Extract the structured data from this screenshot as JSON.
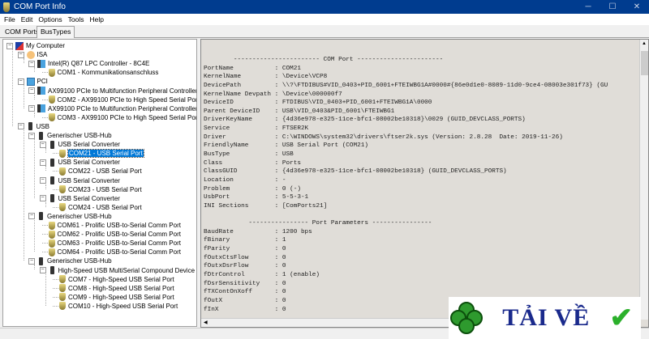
{
  "window": {
    "title": "COM Port Info",
    "controls": [
      "─",
      "☐",
      "✕"
    ]
  },
  "menu": [
    "File",
    "Edit",
    "Options",
    "Tools",
    "Help"
  ],
  "tabs": [
    {
      "label": "COM Ports",
      "active": false
    },
    {
      "label": "BusTypes",
      "active": true
    }
  ],
  "tree": [
    {
      "level": 0,
      "label": "My Computer",
      "icon": "computer",
      "toggle": "−"
    },
    {
      "level": 1,
      "label": "ISA",
      "icon": "isa",
      "toggle": "−"
    },
    {
      "level": 2,
      "label": "Intel(R) Q87 LPC Controller - 8C4E",
      "icon": "controller",
      "toggle": "−"
    },
    {
      "level": 3,
      "label": "COM1 - Kommunikationsanschluss",
      "icon": "port"
    },
    {
      "level": 1,
      "label": "PCI",
      "icon": "bus",
      "toggle": "−"
    },
    {
      "level": 2,
      "label": "AX99100 PCIe to Multifunction Peripheral Controller",
      "icon": "controller",
      "toggle": "−"
    },
    {
      "level": 3,
      "label": "COM2 - AX99100 PCIe to High Speed Serial Port",
      "icon": "port"
    },
    {
      "level": 2,
      "label": "AX99100 PCIe to Multifunction Peripheral Controller",
      "icon": "controller",
      "toggle": "−"
    },
    {
      "level": 3,
      "label": "COM3 - AX99100 PCIe to High Speed Serial Port",
      "icon": "port"
    },
    {
      "level": 1,
      "label": "USB",
      "icon": "usb",
      "toggle": "−"
    },
    {
      "level": 2,
      "label": "Generischer USB-Hub",
      "icon": "usb",
      "toggle": "−"
    },
    {
      "level": 3,
      "label": "USB Serial Converter",
      "icon": "usb",
      "toggle": "−"
    },
    {
      "level": 4,
      "label": "COM21 - USB Serial Port",
      "icon": "port",
      "selected": true
    },
    {
      "level": 3,
      "label": "USB Serial Converter",
      "icon": "usb",
      "toggle": "−"
    },
    {
      "level": 4,
      "label": "COM22 - USB Serial Port",
      "icon": "port"
    },
    {
      "level": 3,
      "label": "USB Serial Converter",
      "icon": "usb",
      "toggle": "−"
    },
    {
      "level": 4,
      "label": "COM23 - USB Serial Port",
      "icon": "port"
    },
    {
      "level": 3,
      "label": "USB Serial Converter",
      "icon": "usb",
      "toggle": "−"
    },
    {
      "level": 4,
      "label": "COM24 - USB Serial Port",
      "icon": "port"
    },
    {
      "level": 2,
      "label": "Generischer USB-Hub",
      "icon": "usb",
      "toggle": "−"
    },
    {
      "level": 3,
      "label": "COM61 - Prolific USB-to-Serial Comm Port",
      "icon": "port"
    },
    {
      "level": 3,
      "label": "COM62 - Prolific USB-to-Serial Comm Port",
      "icon": "port"
    },
    {
      "level": 3,
      "label": "COM63 - Prolific USB-to-Serial Comm Port",
      "icon": "port"
    },
    {
      "level": 3,
      "label": "COM64 - Prolific USB-to-Serial Comm Port",
      "icon": "port"
    },
    {
      "level": 2,
      "label": "Generischer USB-Hub",
      "icon": "usb",
      "toggle": "−"
    },
    {
      "level": 3,
      "label": "High-Speed USB MultiSerial Compound Device",
      "icon": "usb",
      "toggle": "−"
    },
    {
      "level": 4,
      "label": "COM7 - High-Speed USB Serial Port",
      "icon": "port"
    },
    {
      "level": 4,
      "label": "COM8 - High-Speed USB Serial Port",
      "icon": "port"
    },
    {
      "level": 4,
      "label": "COM9 - High-Speed USB Serial Port",
      "icon": "port"
    },
    {
      "level": 4,
      "label": "COM10 - High-Speed USB Serial Port",
      "icon": "port"
    }
  ],
  "info_lines": [
    "        ----------------------- COM Port -----------------------",
    "PortName           : COM21",
    "KernelName         : \\Device\\VCP8",
    "DevicePath         : \\\\?\\FTDIBUS#VID_0403+PID_6001+FTEIWBG1A#0000#{86e0d1e0-8089-11d0-9ce4-08003e301f73} (GU",
    "KernelName Devpath : \\Device\\000000f7",
    "DeviceID           : FTDIBUS\\VID_0403+PID_6001+FTEIWBG1A\\0000",
    "Parent DeviceID    : USB\\VID_0403&PID_6001\\FTEIWBG1",
    "DriverKeyName      : {4d36e978-e325-11ce-bfc1-08002be10318}\\0029 (GUID_DEVCLASS_PORTS)",
    "Service            : FTSER2K",
    "Driver             : C:\\WINDOWS\\system32\\drivers\\ftser2k.sys (Version: 2.8.28  Date: 2019-11-26)",
    "FriendlyName       : USB Serial Port (COM21)",
    "BusType            : USB",
    "Class              : Ports",
    "ClassGUID          : {4d36e978-e325-11ce-bfc1-08002be10318} (GUID_DEVCLASS_PORTS)",
    "Location           : -",
    "Problem            : 0 (-)",
    "UsbPort            : 5-5-3-1",
    "INI Sections       : [ComPorts21]",
    "",
    "            ---------------- Port Parameters ----------------",
    "BaudRate           : 1200 bps",
    "fBinary            : 1",
    "fParity            : 0",
    "fOutxCtsFlow       : 0",
    "fOutxDsrFlow       : 0",
    "fDtrControl        : 1 (enable)",
    "fDsrSensitivity    : 0",
    "fTXContOnXoff      : 0",
    "fOutX              : 0",
    "fInX               : 0"
  ],
  "watermark": {
    "text": "TẢI VỀ"
  },
  "colors": {
    "titlebar": "#003c8f",
    "selection": "#0078d7",
    "info_bg": "#e0ddd8"
  }
}
